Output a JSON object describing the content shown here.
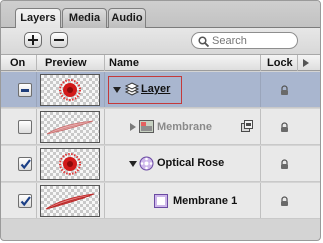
{
  "tabs": [
    {
      "label": "Layers"
    },
    {
      "label": "Media"
    },
    {
      "label": "Audio"
    }
  ],
  "toolbar": {
    "search_placeholder": "Search"
  },
  "columns": {
    "on": "On",
    "preview": "Preview",
    "name": "Name",
    "lock": "Lock"
  },
  "rows": [
    {
      "name": "Layer",
      "on": "mixed",
      "selected": true,
      "icon": "layer-stack-icon",
      "expanded": true
    },
    {
      "name": "Membrane",
      "on": false,
      "icon": "image-layer-icon",
      "expanded": false
    },
    {
      "name": "Optical Rose",
      "on": true,
      "icon": "particle-emitter-icon",
      "expanded": true
    },
    {
      "name": "Membrane 1",
      "on": true,
      "icon": "particle-cell-icon"
    }
  ],
  "colors": {
    "selection": "#a9b6cf",
    "highlight_box": "#c43a3a",
    "preview_red": "#d11a1a"
  }
}
